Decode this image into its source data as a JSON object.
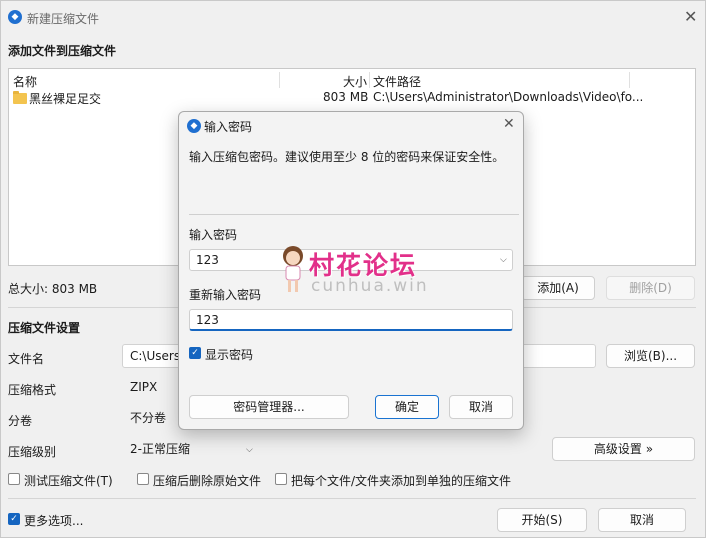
{
  "window": {
    "title": "新建压缩文件",
    "add_section_title": "添加文件到压缩文件",
    "columns": {
      "name": "名称",
      "size": "大小",
      "path": "文件路径"
    },
    "files": [
      {
        "name": "黑丝裸足足交",
        "size": "803 MB",
        "path": "C:\\Users\\Administrator\\Downloads\\Video\\fo..."
      }
    ],
    "total_size": "总大小: 803 MB",
    "add_button": "添加(A)",
    "delete_button": "删除(D)",
    "settings_title": "压缩文件设置",
    "filename_label": "文件名",
    "filename_value": "C:\\Users\\",
    "browse_button": "浏览(B)...",
    "format_label": "压缩格式",
    "format_value": "ZIPX",
    "split_label": "分卷",
    "split_value": "不分卷",
    "level_label": "压缩级别",
    "level_value": "2-正常压缩",
    "advanced_button": "高级设置 »",
    "test_checkbox": "测试压缩文件(T)",
    "delete_after_checkbox": "压缩后删除原始文件",
    "separate_checkbox": "把每个文件/文件夹添加到单独的压缩文件",
    "more_options_checkbox": "更多选项...",
    "start_button": "开始(S)",
    "cancel_button": "取消"
  },
  "dialog": {
    "title": "输入密码",
    "description": "输入压缩包密码。建议使用至少 8 位的密码来保证安全性。",
    "password_label": "输入密码",
    "password_value": "123",
    "reenter_label": "重新输入密码",
    "reenter_value": "123",
    "show_password_checkbox": "显示密码",
    "manager_button": "密码管理器...",
    "ok_button": "确定",
    "cancel_button": "取消"
  },
  "watermark": {
    "text": "村花论坛",
    "sub": "cunhua.win"
  },
  "colors": {
    "accent": "#1565c0",
    "watermark": "#e2308a"
  }
}
